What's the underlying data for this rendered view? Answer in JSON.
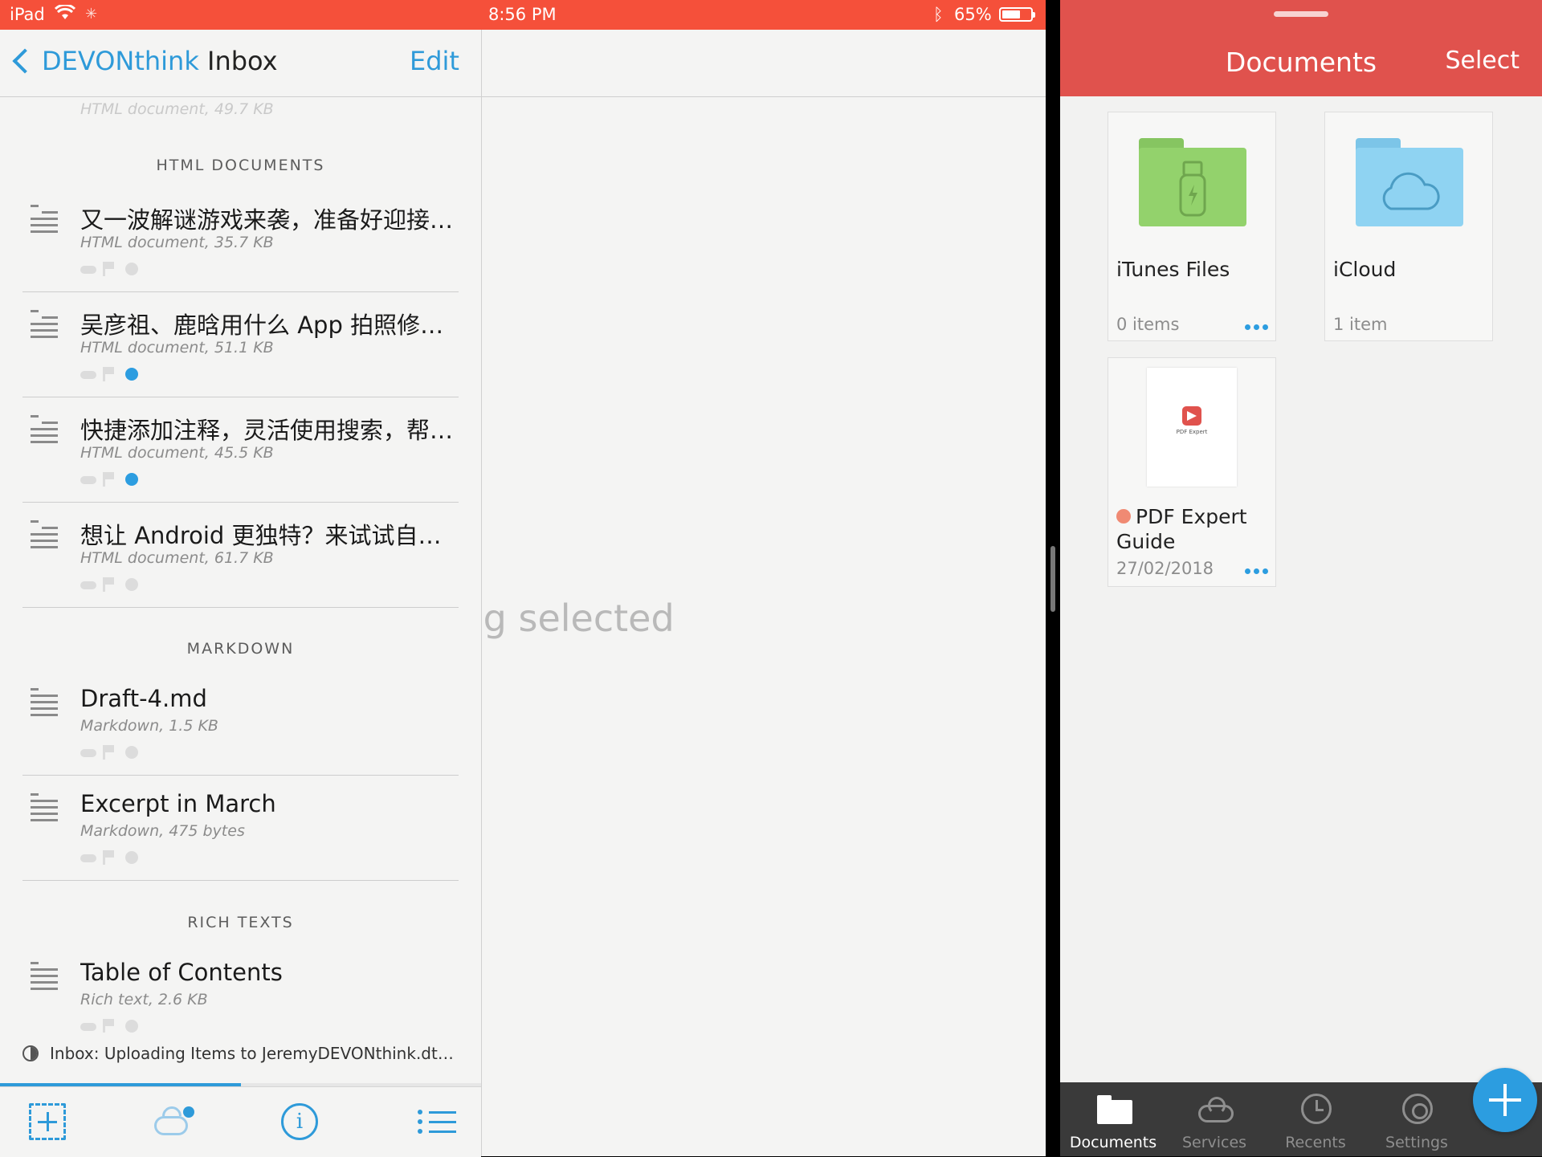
{
  "status_bar": {
    "device": "iPad",
    "time": "8:56 PM",
    "battery_text": "65%",
    "battery_level": 0.65,
    "wifi_icon": "wifi-icon",
    "bluetooth_icon": "bluetooth-icon"
  },
  "devonthink": {
    "back_label": "DEVONthink",
    "title": "Inbox",
    "edit_label": "Edit",
    "accent_color": "#2e9ad9",
    "ghost_meta": "HTML document, 49.7 KB",
    "detail_placeholder": "Nothing selected",
    "sections": [
      {
        "header": "HTML DOCUMENTS",
        "items": [
          {
            "title": "又一波解谜游戏来袭，准备好迎接…",
            "meta": "HTML document, 35.7 KB",
            "label_dot": "none"
          },
          {
            "title": "吴彦祖、鹿晗用什么 App 拍照修…",
            "meta": "HTML document, 51.1 KB",
            "label_dot": "blue"
          },
          {
            "title": "快捷添加注释，灵活使用搜索，帮…",
            "meta": "HTML document, 45.5 KB",
            "label_dot": "blue"
          },
          {
            "title": "想让 Android 更独特？来试试自…",
            "meta": "HTML document, 61.7 KB",
            "label_dot": "none"
          }
        ]
      },
      {
        "header": "MARKDOWN",
        "items": [
          {
            "title": "Draft-4.md",
            "meta": "Markdown, 1.5 KB",
            "label_dot": "none"
          },
          {
            "title": "Excerpt in March",
            "meta": "Markdown, 475 bytes",
            "label_dot": "none"
          }
        ]
      },
      {
        "header": "RICH TEXTS",
        "items": [
          {
            "title": "Table of Contents",
            "meta": "Rich text, 2.6 KB",
            "label_dot": "none"
          }
        ]
      }
    ],
    "sync_status": "Inbox: Uploading Items to JeremyDEVONthink.dtCl...",
    "upload_progress": 0.5,
    "toolbar_icons": [
      "add-icon",
      "cloud-sync-icon",
      "info-icon",
      "list-icon"
    ]
  },
  "pdf_expert": {
    "title": "Documents",
    "select_label": "Select",
    "header_color": "#e0524d",
    "files": [
      {
        "name": "iTunes Files",
        "sub": "0 items",
        "icon": "usb-folder-icon",
        "color": "#93d26c"
      },
      {
        "name": "iCloud",
        "sub": "1 item",
        "icon": "cloud-folder-icon",
        "color": "#8fd3f2"
      },
      {
        "name_line1": "PDF Expert",
        "name_line2": "Guide",
        "sub": "27/02/2018",
        "icon": "pdf-thumbnail",
        "tag_color": "#f08a73",
        "thumb_caption": "PDF Expert"
      }
    ],
    "tabs": [
      {
        "label": "Documents",
        "icon": "folder-icon",
        "active": true
      },
      {
        "label": "Services",
        "icon": "cloud-icon",
        "active": false
      },
      {
        "label": "Recents",
        "icon": "clock-icon",
        "active": false
      },
      {
        "label": "Settings",
        "icon": "gear-icon",
        "active": false
      }
    ],
    "fab_icon": "plus-icon"
  }
}
